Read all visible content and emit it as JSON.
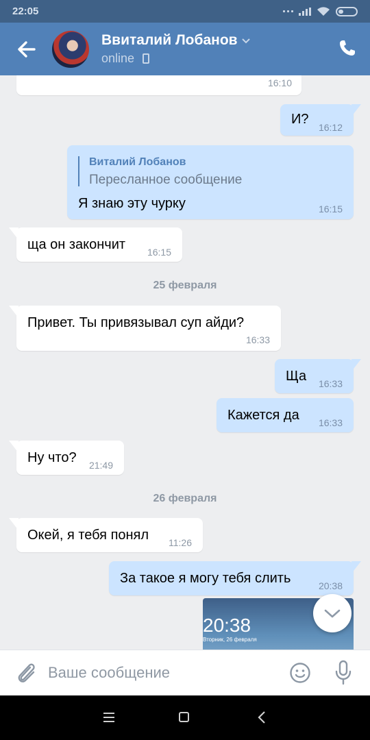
{
  "status_bar": {
    "time": "22:05"
  },
  "header": {
    "contact_name": "Ввиталий Лобанов",
    "contact_status": "online"
  },
  "messages": [
    {
      "direction": "in",
      "text": "",
      "time": "16:10"
    },
    {
      "direction": "out",
      "text": "И?",
      "time": "16:12"
    },
    {
      "direction": "out",
      "forwarded_from": "Виталий Лобанов",
      "forwarded_label": "Пересланное сообщение",
      "text": "Я знаю эту чурку",
      "time": "16:15"
    },
    {
      "direction": "in",
      "text": "ща он закончит",
      "time": "16:15"
    },
    {
      "direction": "in",
      "text": "Привет. Ты привязывал суп айди?",
      "time": "16:33"
    },
    {
      "direction": "out",
      "text": "Ща",
      "time": "16:33"
    },
    {
      "direction": "out",
      "text": "Кажется да",
      "time": "16:33"
    },
    {
      "direction": "in",
      "text": "Ну что?",
      "time": "21:49"
    },
    {
      "direction": "in",
      "text": "Окей, я тебя понял",
      "time": "11:26"
    },
    {
      "direction": "out",
      "text": "За такое я могу тебя слить",
      "time": "20:38"
    }
  ],
  "date_separators": [
    "25 февраля",
    "26 февраля"
  ],
  "image_preview": {
    "time": "20:38",
    "date": "Вторник, 26 февраля"
  },
  "composer": {
    "placeholder": "Ваше сообщение",
    "value": ""
  },
  "icons": {
    "back": "arrow-left-icon",
    "call": "phone-icon",
    "attach": "paperclip-icon",
    "emoji": "smile-icon",
    "voice": "microphone-icon",
    "scroll": "chevron-down-icon"
  },
  "colors": {
    "header": "#5181b8",
    "status_bar": "#3f6187",
    "outgoing_bubble": "#cce4ff",
    "incoming_bubble": "#ffffff",
    "background": "#edeef0"
  }
}
